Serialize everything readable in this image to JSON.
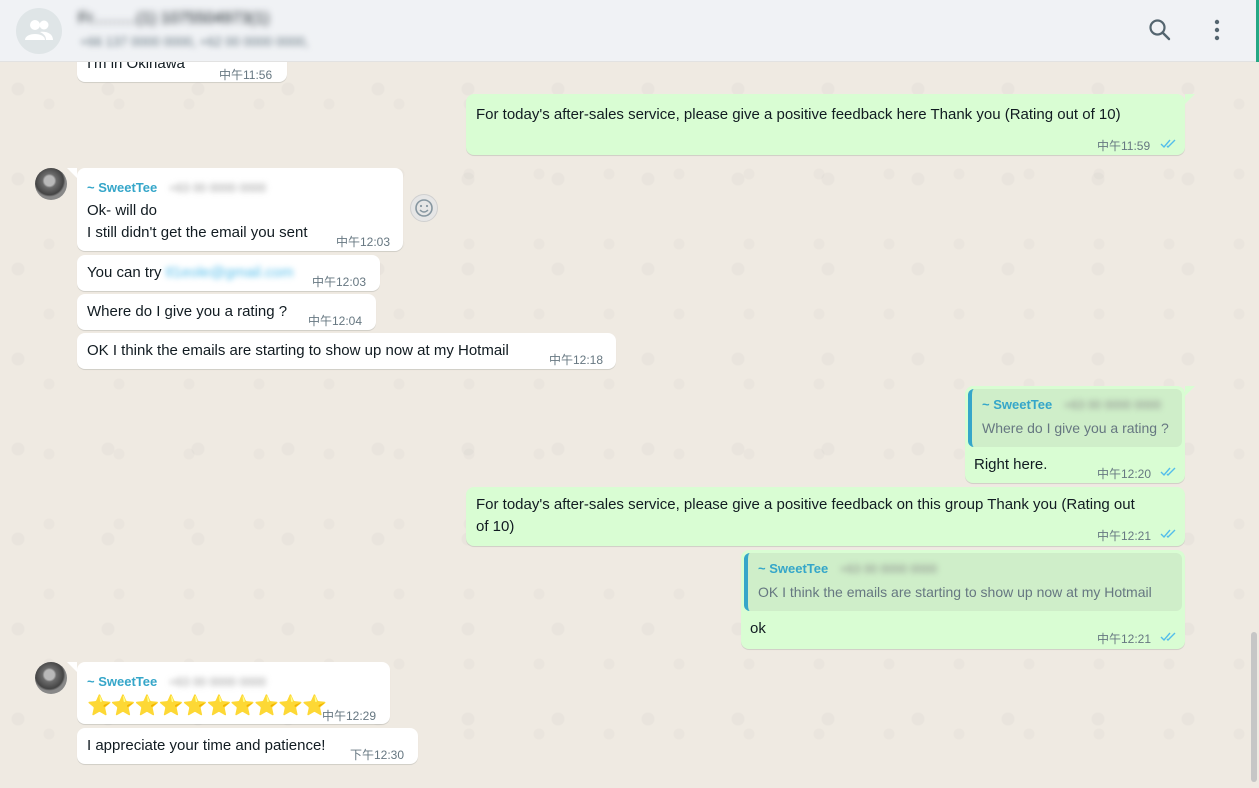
{
  "header": {
    "group_name": "Fr..........(1) 1075504973(1)",
    "participants": "+66 137 0000 0000,   +62 00 0000 0000,  ",
    "icons": [
      "group-avatar-icon",
      "search-icon",
      "menu-dots-icon"
    ]
  },
  "colors": {
    "outgoing": "#d9fdd3",
    "incoming": "#ffffff",
    "sender": "#35a6c9",
    "ticks": "#53bdeb"
  },
  "messages": [
    {
      "direction": "in",
      "text": "I'm in Okinawa",
      "time": "中午11:56"
    },
    {
      "direction": "out",
      "text": "For today's after-sales service, please give a positive feedback here Thank you (Rating out of 10)",
      "time": "中午11:59",
      "read": true
    },
    {
      "direction": "in",
      "sender": "~ SweetTee",
      "sender_number": "+63 00 0000 0000",
      "lines": [
        "Ok- will do",
        "I still didn't get the email you sent"
      ],
      "time": "中午12:03"
    },
    {
      "direction": "in",
      "text": "You can try",
      "email": "tl1eole@gmail.com",
      "time": "中午12:03"
    },
    {
      "direction": "in",
      "text": "Where do I give you a rating ?",
      "time": "中午12:04"
    },
    {
      "direction": "in",
      "text": "OK I think the emails are starting to show up now at my Hotmail",
      "time": "中午12:18"
    },
    {
      "direction": "out",
      "quote": {
        "sender": "~ SweetTee",
        "sender_number": "+63 00 0000 0000",
        "text": "Where do I give you a rating ?"
      },
      "text": "Right here.",
      "time": "中午12:20",
      "read": true
    },
    {
      "direction": "out",
      "lines": [
        "For today's after-sales service, please give a positive feedback on this group Thank you (Rating out",
        "of 10)"
      ],
      "time": "中午12:21",
      "read": true
    },
    {
      "direction": "out",
      "quote": {
        "sender": "~ SweetTee",
        "sender_number": "+63 00 0000 0000",
        "text": "OK I think the emails are starting to show up now at my Hotmail"
      },
      "text": "ok",
      "time": "中午12:21",
      "read": true
    },
    {
      "direction": "in",
      "sender": "~ SweetTee",
      "sender_number": "+63 00 0000 0000",
      "text": "⭐⭐⭐⭐⭐⭐⭐⭐⭐⭐",
      "time": "中午12:29"
    },
    {
      "direction": "in",
      "text": "I appreciate your time and patience!",
      "time": "下午12:30"
    }
  ]
}
